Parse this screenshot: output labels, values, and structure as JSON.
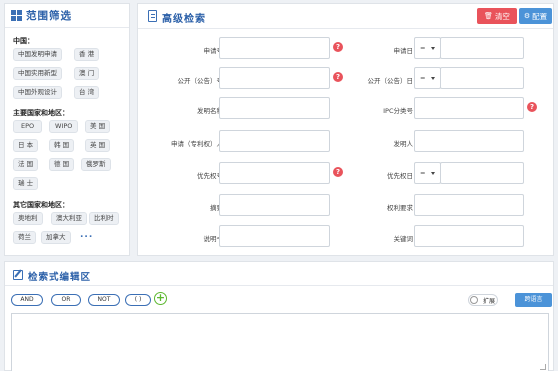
{
  "filter": {
    "title": "范围筛选",
    "group_china": "中国：",
    "china": [
      "中国发明申请",
      "香 港",
      "中国实用新型",
      "澳 门",
      "中国外观设计",
      "台 湾"
    ],
    "group_major": "主要国家和地区：",
    "major": [
      "EPO",
      "WIPO",
      "美 国",
      "日 本",
      "韩 国",
      "英 国",
      "法 国",
      "德 国",
      "俄罗斯",
      "瑞 士"
    ],
    "group_other": "其它国家和地区：",
    "other": [
      "奥地利",
      "澳大利亚",
      "比利时",
      "荷兰",
      "加拿大"
    ],
    "more": "..."
  },
  "search": {
    "title": "高级检索",
    "clear_label": "清空",
    "config_label": "配置",
    "op_default": "=",
    "fields": {
      "app_no": "申请号",
      "app_date": "申请日",
      "pub_no": "公开（公告）号",
      "pub_date": "公开（公告）日",
      "title": "发明名称",
      "ipc": "IPC分类号",
      "applicant": "申请（专利权）人",
      "inventor": "发明人",
      "priority_no": "优先权号",
      "priority_date": "优先权日",
      "abstract": "摘要",
      "claims": "权利要求",
      "description": "说明书",
      "keyword": "关键词"
    },
    "help_mark": "?"
  },
  "editor": {
    "title": "检索式编辑区",
    "ops": [
      "AND",
      "OR",
      "NOT",
      "( )"
    ],
    "plus": "+",
    "expand_label": "扩展",
    "translate_label": "跨语言"
  },
  "colors": {
    "accent": "#2a5fa8",
    "danger": "#e9535b",
    "primary": "#4b93d8",
    "add": "#5cb82f"
  }
}
